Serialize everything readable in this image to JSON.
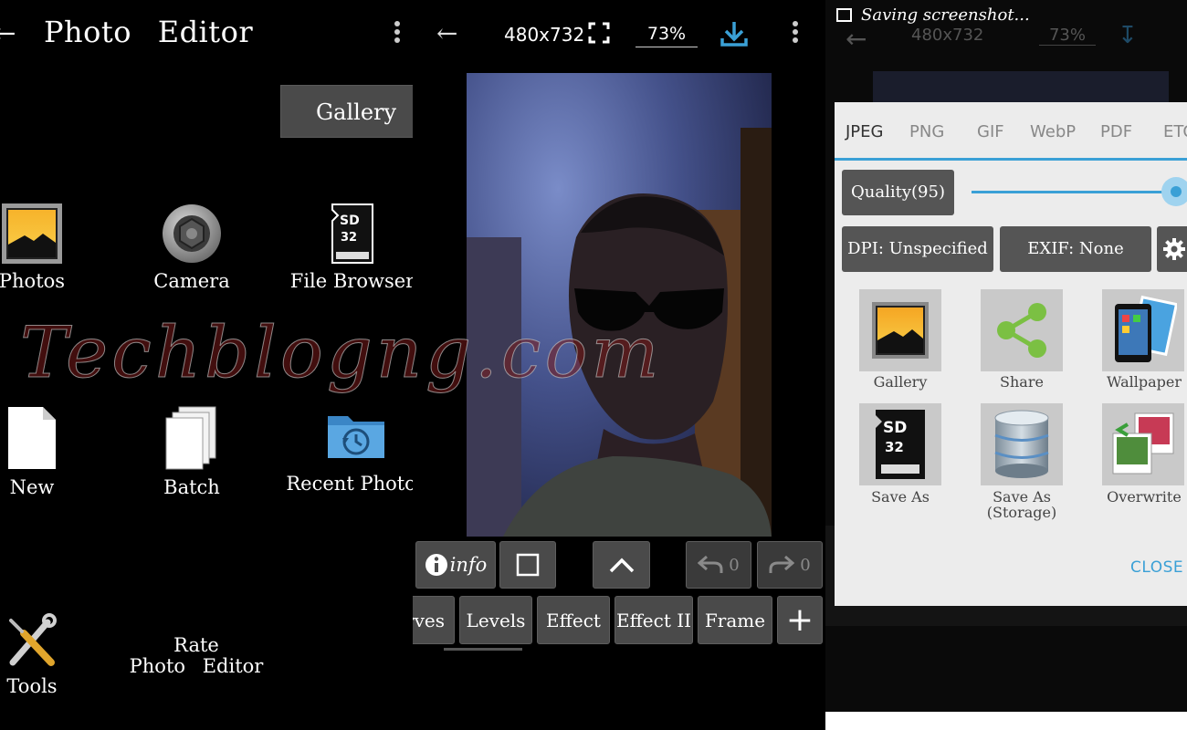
{
  "home": {
    "title": "Photo Editor",
    "gallery_button": "Gallery",
    "items": [
      {
        "label": "Photos"
      },
      {
        "label": "Camera"
      },
      {
        "label": "File Browser"
      },
      {
        "label": "New"
      },
      {
        "label": "Batch"
      },
      {
        "label": "Recent Photos"
      },
      {
        "label": "Tools"
      }
    ],
    "rate_line1": "Rate",
    "rate_line2": "Photo Editor"
  },
  "editor": {
    "image_size": "480x732",
    "zoom": "73%",
    "toolbar": {
      "info_label": "info",
      "undo_count": "0",
      "redo_count": "0"
    },
    "effects": [
      "rves",
      "Levels",
      "Effect",
      "Effect II",
      "Frame"
    ],
    "add_symbol": "+"
  },
  "save_dialog": {
    "status_text": "Saving screenshot...",
    "ghost_size": "480x732",
    "ghost_zoom": "73%",
    "tabs": [
      "JPEG",
      "PNG",
      "GIF",
      "WebP",
      "PDF",
      "ETC"
    ],
    "active_tab": "JPEG",
    "quality_label": "Quality(95)",
    "quality_value": 95,
    "dpi_label": "DPI: Unspecified",
    "exif_label": "EXIF: None",
    "targets": [
      {
        "label": "Gallery"
      },
      {
        "label": "Share"
      },
      {
        "label": "Wallpaper"
      },
      {
        "label": "Save As"
      },
      {
        "label": "Save As\n(Storage)"
      },
      {
        "label": "Overwrite"
      }
    ],
    "close_label": "CLOSE"
  },
  "watermark": "Techblogng.com",
  "colors": {
    "accent": "#3aa0d6",
    "button_dark": "#4a4a4a",
    "dialog_bg": "#ececec",
    "share_green": "#7bc043",
    "icon_orange": "#f5a623"
  }
}
